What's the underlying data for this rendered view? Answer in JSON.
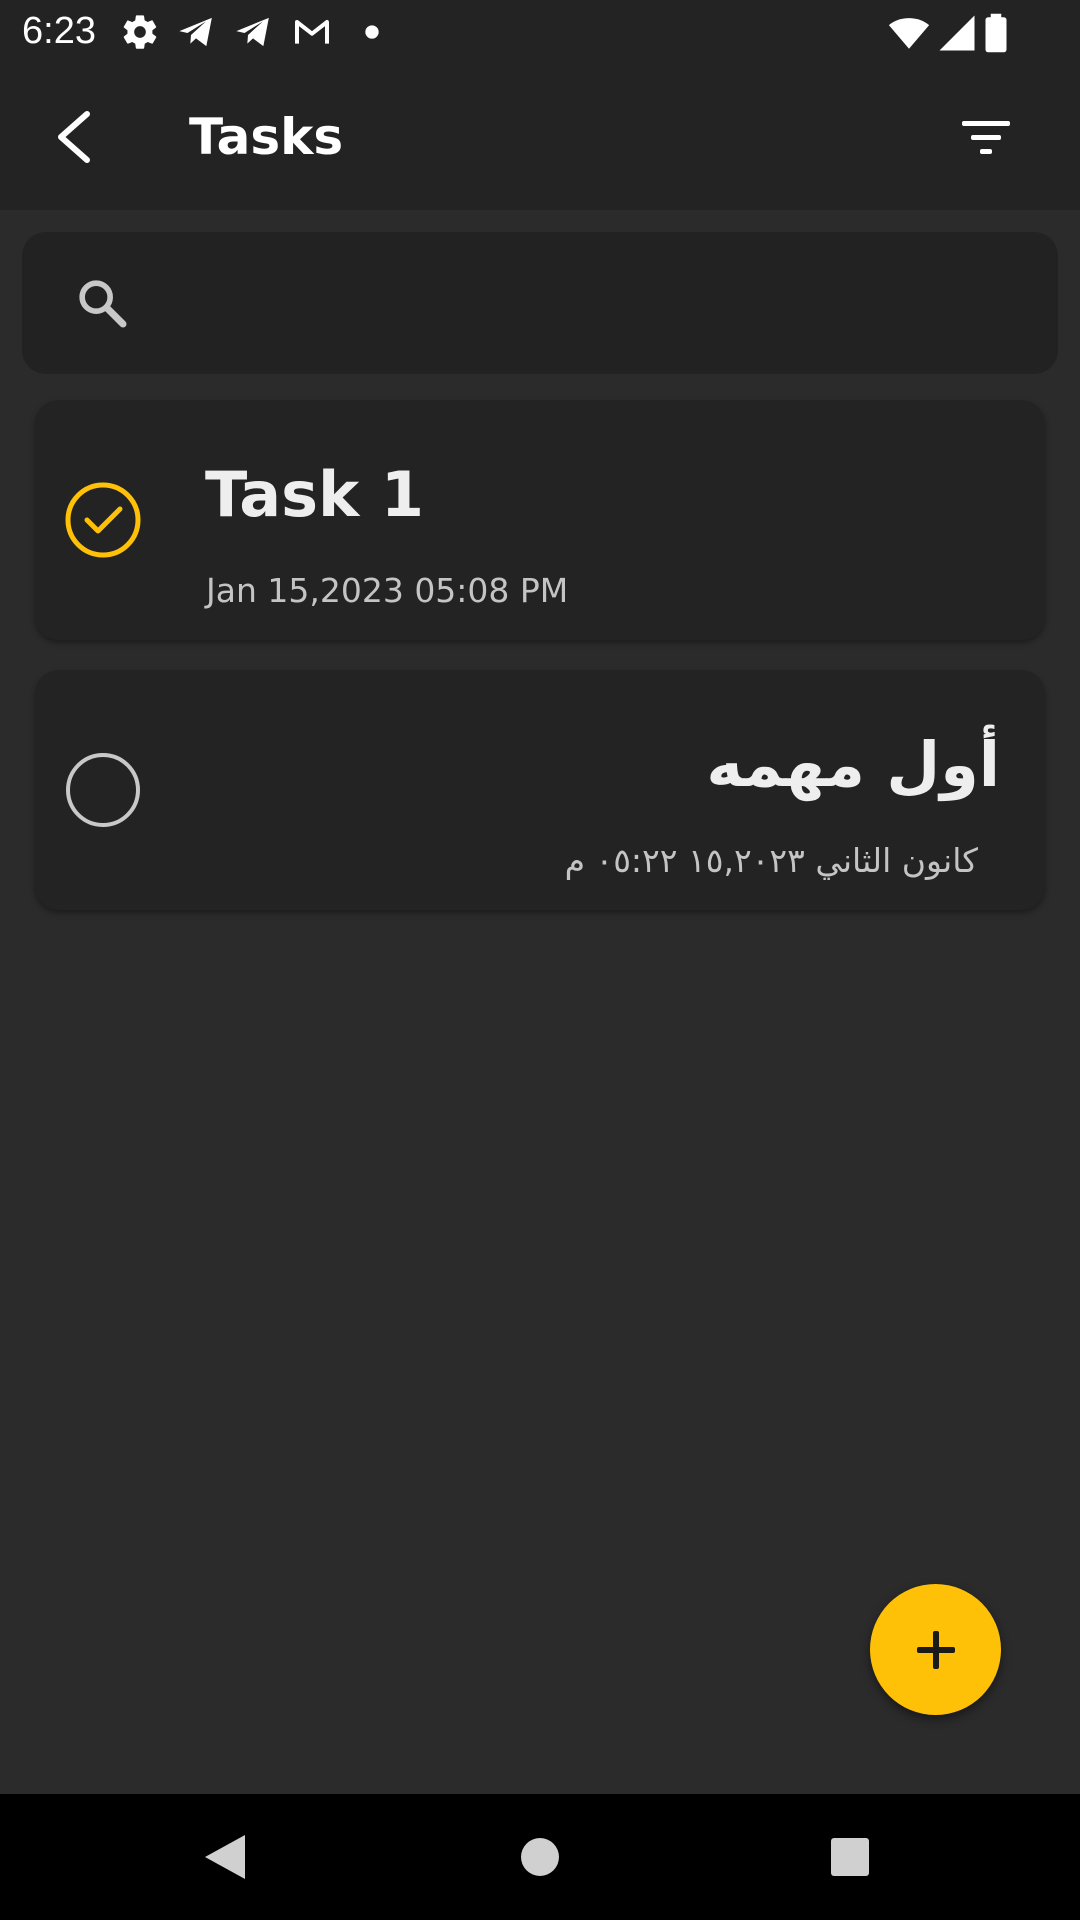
{
  "status_bar": {
    "time": "6:23",
    "left_icons": [
      "gear-icon",
      "telegram-icon",
      "telegram-icon",
      "gmail-icon",
      "dot-icon"
    ],
    "right_icons": [
      "wifi-icon",
      "signal-icon",
      "battery-icon"
    ]
  },
  "app_bar": {
    "title": "Tasks",
    "back_icon": "chevron-left-icon",
    "filter_icon": "filter-icon"
  },
  "search": {
    "icon": "search-icon",
    "value": "",
    "placeholder": ""
  },
  "tasks": [
    {
      "title": "Task 1",
      "date": "Jan 15,2023  05:08 PM",
      "completed": true,
      "direction": "ltr"
    },
    {
      "title": "أول مهمه",
      "date": "كانون الثاني ١٥,٢٠٢٣  ٠٥:٢٢ م",
      "completed": false,
      "direction": "rtl"
    }
  ],
  "fab": {
    "icon": "plus-icon"
  },
  "nav_bar": {
    "icons": [
      "back-triangle-icon",
      "home-circle-icon",
      "recents-square-icon"
    ]
  },
  "colors": {
    "background": "#2b2b2b",
    "surface": "#232323",
    "accent": "#ffc107",
    "text_primary": "#eeeeee",
    "text_secondary": "#c4c4c4"
  }
}
